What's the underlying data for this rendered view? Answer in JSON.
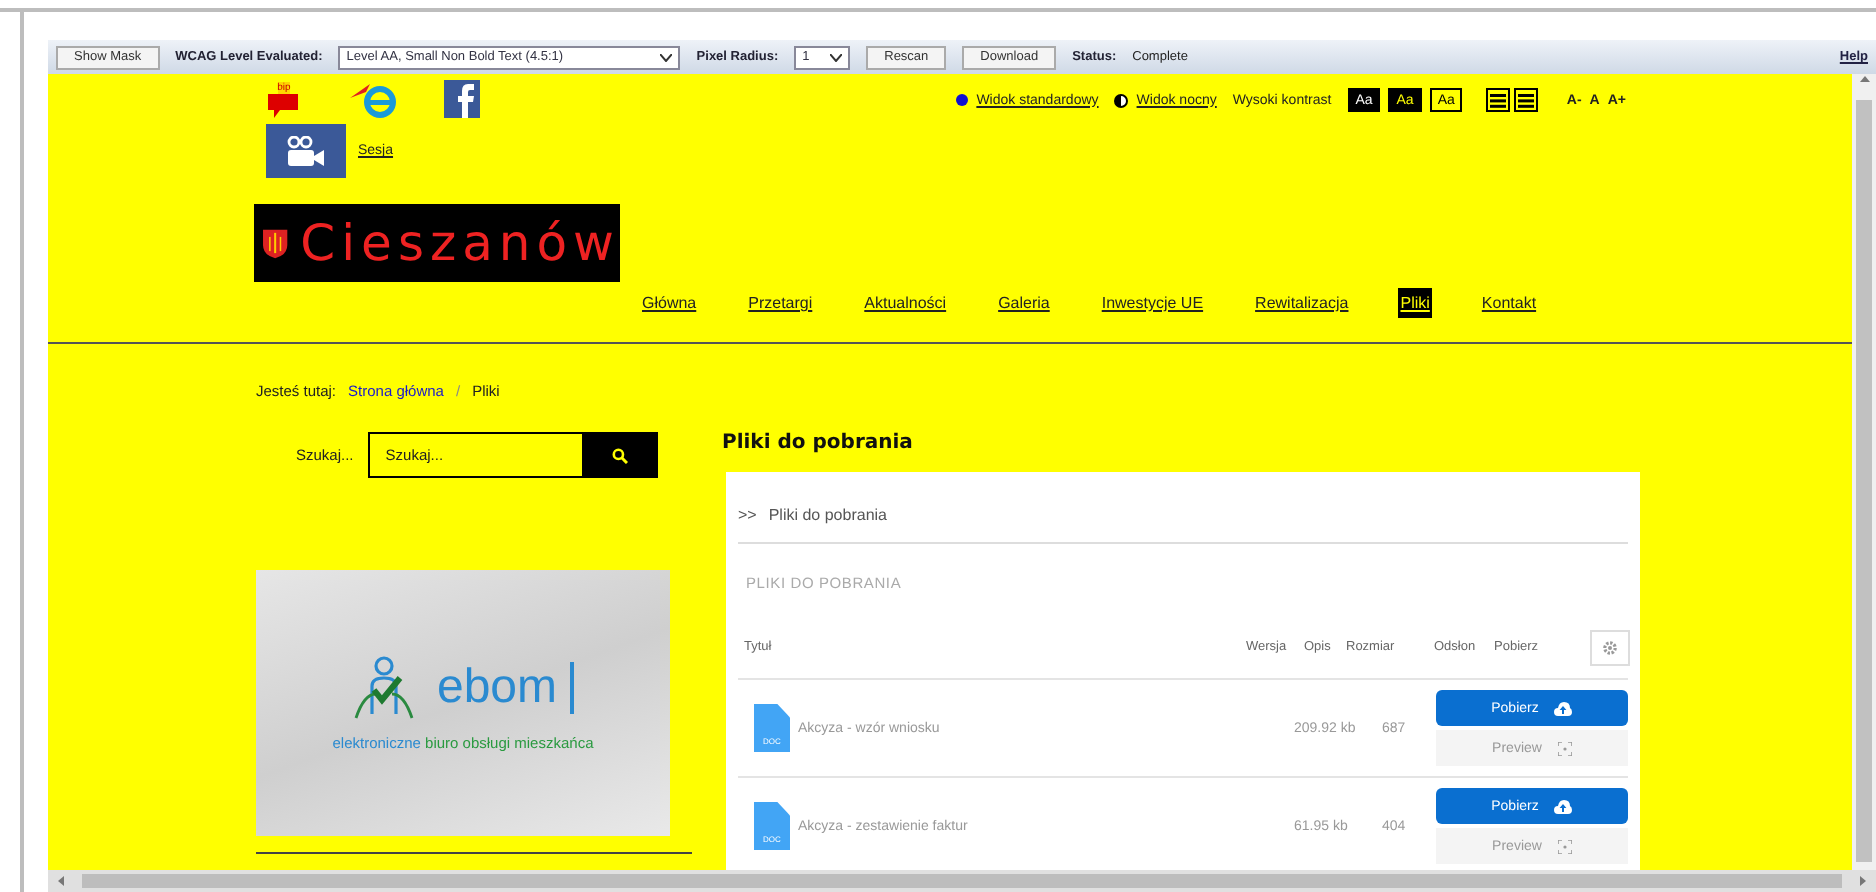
{
  "toolbar": {
    "show_mask": "Show Mask",
    "wcag_label": "WCAG Level Evaluated:",
    "wcag_value": "Level AA, Small Non Bold Text (4.5:1)",
    "pixel_label": "Pixel Radius:",
    "pixel_value": "1",
    "rescan": "Rescan",
    "download": "Download",
    "status_label": "Status:",
    "status_value": "Complete",
    "help": "Help"
  },
  "header": {
    "bip_label": "bip",
    "session_link": "Sesja",
    "views": [
      {
        "label": "Widok standardowy",
        "kind": "dot"
      },
      {
        "label": "Widok nocny",
        "kind": "half"
      }
    ],
    "contrast_label": "Wysoki kontrast",
    "contrast_buttons": [
      {
        "label": "Aa",
        "kind": "black-white"
      },
      {
        "label": "Aa",
        "kind": "black-yellow"
      },
      {
        "label": "Aa",
        "kind": "yellow-black"
      }
    ],
    "font_sizes": [
      "A-",
      "A",
      "A+"
    ],
    "logo": "Cieszanów",
    "nav": [
      {
        "label": "Główna",
        "selected": false
      },
      {
        "label": "Przetargi",
        "selected": false
      },
      {
        "label": "Aktualności",
        "selected": false
      },
      {
        "label": "Galeria",
        "selected": false
      },
      {
        "label": "Inwestycje UE",
        "selected": false
      },
      {
        "label": "Rewitalizacja",
        "selected": false
      },
      {
        "label": "Pliki",
        "selected": true
      },
      {
        "label": "Kontakt",
        "selected": false
      }
    ]
  },
  "breadcrumb": {
    "label": "Jesteś tutaj:",
    "items": [
      "Strona główna",
      "Pliki"
    ],
    "separator": "/"
  },
  "search": {
    "label": "Szukaj...",
    "placeholder": "Szukaj..."
  },
  "banner": {
    "title": "ebom",
    "subtitle_start": "elektroniczne",
    "subtitle_end": "biuro obsługi mieszkańca"
  },
  "files": {
    "heading": "Pliki do pobrania",
    "crumb_marker": ">>",
    "crumb": "Pliki do pobrania",
    "section_title": "PLIKI DO POBRANIA",
    "columns": [
      "Tytuł",
      "Wersja",
      "Opis",
      "Rozmiar",
      "Odsłon",
      "Pobierz"
    ],
    "rows": [
      {
        "type_label": "DOC",
        "title": "Akcyza - wzór wniosku",
        "size": "209.92 kb",
        "views": "687",
        "download": "Pobierz",
        "preview": "Preview"
      },
      {
        "type_label": "DOC",
        "title": "Akcyza - zestawienie faktur",
        "size": "61.95 kb",
        "views": "404",
        "download": "Pobierz",
        "preview": "Preview"
      }
    ]
  }
}
